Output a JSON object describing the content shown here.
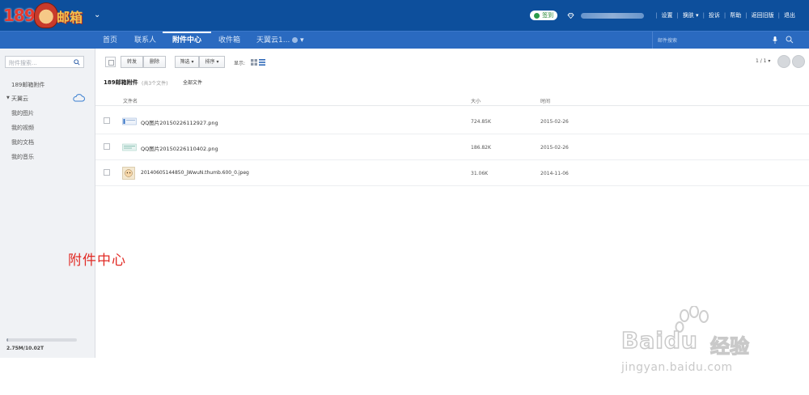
{
  "header": {
    "logo_text": "189邮箱",
    "signin_label": "签到",
    "links": [
      "设置",
      "换肤",
      "投诉",
      "帮助",
      "返回旧版",
      "退出"
    ]
  },
  "nav": {
    "tabs": [
      "首页",
      "联系人",
      "附件中心",
      "收件箱",
      "天翼云1..."
    ],
    "active_tab": "附件中心",
    "search_placeholder": "邮件搜索"
  },
  "sidebar": {
    "search_placeholder": "附件搜索...",
    "items": [
      "189邮箱附件",
      "天翼云",
      "我的图片",
      "我的视频",
      "我的文档",
      "我的音乐"
    ],
    "storage_used_fraction": 0.0003,
    "storage_text": "2.75M/10.02T"
  },
  "toolbar": {
    "forward_label": "转发",
    "delete_label": "删除",
    "filter_label": "筛选",
    "sort_label": "排序",
    "display_label": "显示:",
    "page_indicator": "1 / 1"
  },
  "folder": {
    "title": "189邮箱附件",
    "count": "(共3个文件)",
    "all_files_label": "全部文件"
  },
  "table": {
    "columns": [
      "文件名",
      "大小",
      "时间"
    ],
    "rows": [
      {
        "name": "QQ图片20150226112927.png",
        "size": "724.85K",
        "time": "2015-02-26"
      },
      {
        "name": "QQ图片20150226110402.png",
        "size": "186.82K",
        "time": "2015-02-26"
      },
      {
        "name": "20140605144850_jWwuN.thumb.600_0.jpeg",
        "size": "31.06K",
        "time": "2014-11-06"
      }
    ]
  },
  "annotation": "附件中心",
  "watermark": {
    "brand": "Bai",
    "brand_suffix": "du",
    "cn": "经验",
    "url": "jingyan.baidu.com"
  },
  "colors": {
    "topbar": "#0d4f9c",
    "navbar": "#2a6ac0",
    "annotation": "#e12a24"
  }
}
